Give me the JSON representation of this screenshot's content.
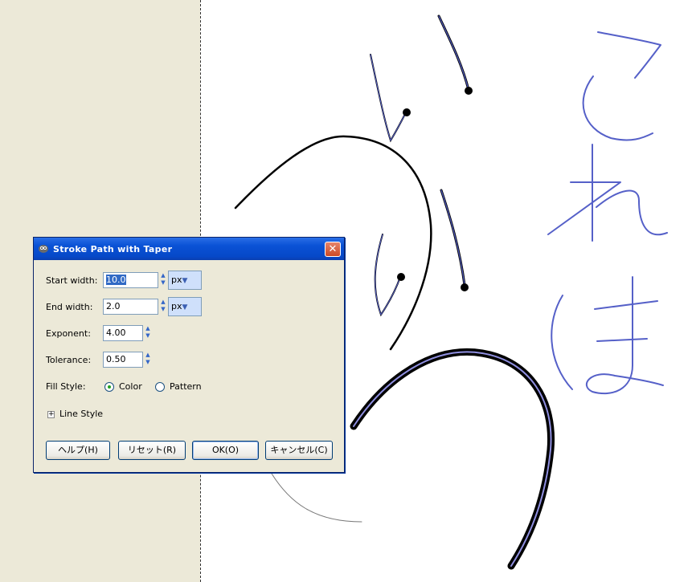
{
  "dialog": {
    "title": "Stroke Path with Taper",
    "close_label": "✕",
    "start_width": {
      "label": "Start width:",
      "mnemonic": "S",
      "value": "10.0",
      "unit": "px"
    },
    "end_width": {
      "label": "End width:",
      "mnemonic": "E",
      "value": "2.0",
      "unit": "px"
    },
    "exponent": {
      "label": "Exponent:",
      "mnemonic": "x",
      "value": "4.00"
    },
    "tolerance": {
      "label": "Tolerance:",
      "mnemonic": "T",
      "value": "0.50"
    },
    "fill_style": {
      "label": "Fill Style:",
      "mnemonic": "F",
      "options": [
        "Color",
        "Pattern"
      ],
      "selected": "Color"
    },
    "line_style": {
      "label": "Line Style",
      "mnemonic": "L",
      "expander": "+"
    },
    "buttons": {
      "help": "ヘルプ(H)",
      "reset": "リセット(R)",
      "ok": "OK(O)",
      "cancel": "キャンセル(C)"
    }
  },
  "icons": [
    "app-icon",
    "close-icon",
    "spin-up-icon",
    "spin-down-icon",
    "chevron-down-icon",
    "expander-plus-icon"
  ],
  "colors": {
    "panel": "#ece9d8",
    "titlebar": "#0a52d6",
    "close": "#cc4a25",
    "stroke_blue": "#5560c8",
    "stroke_black": "#000000"
  }
}
